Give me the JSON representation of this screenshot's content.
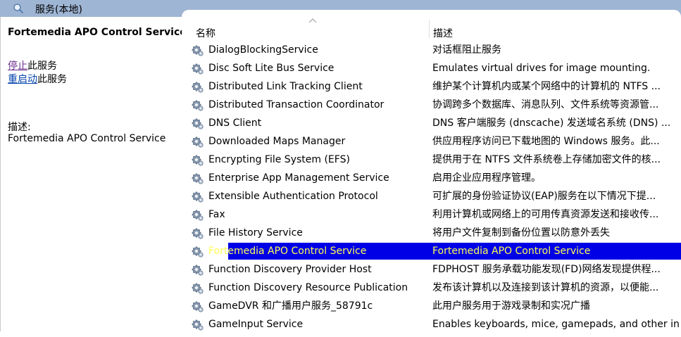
{
  "window": {
    "title": "服务(本地)"
  },
  "left": {
    "service_title": "Fortemedia APO Control Service",
    "stop_link": "停止",
    "stop_suffix": "此服务",
    "restart_link": "重启动",
    "restart_suffix": "此服务",
    "desc_label": "描述:",
    "desc_text": "Fortemedia APO Control Service"
  },
  "table": {
    "headers": {
      "name": "名称",
      "desc": "描述"
    },
    "selected_index": 12,
    "rows": [
      {
        "name": "DialogBlockingService",
        "desc": "对话框阻止服务"
      },
      {
        "name": "Disc Soft Lite Bus Service",
        "desc": "Emulates virtual drives for image mounting."
      },
      {
        "name": "Distributed Link Tracking Client",
        "desc": "维护某个计算机内或某个网络中的计算机的 NTFS ..."
      },
      {
        "name": "Distributed Transaction Coordinator",
        "desc": "协调跨多个数据库、消息队列、文件系统等资源管..."
      },
      {
        "name": "DNS Client",
        "desc": "DNS 客户端服务 (dnscache) 发送域名系统 (DNS) ..."
      },
      {
        "name": "Downloaded Maps Manager",
        "desc": "供应用程序访问已下载地图的 Windows 服务。此..."
      },
      {
        "name": "Encrypting File System (EFS)",
        "desc": "提供用于在 NTFS 文件系统卷上存储加密文件的核..."
      },
      {
        "name": "Enterprise App Management Service",
        "desc": "启用企业应用程序管理。"
      },
      {
        "name": "Extensible Authentication Protocol",
        "desc": "可扩展的身份验证协议(EAP)服务在以下情况下提..."
      },
      {
        "name": "Fax",
        "desc": "利用计算机或网络上的可用传真资源发送和接收传..."
      },
      {
        "name": "File History Service",
        "desc": "将用户文件复制到备份位置以防意外丢失"
      },
      {
        "name": "Fortemedia APO Control Service",
        "desc": "Fortemedia APO Control Service"
      },
      {
        "name": "Function Discovery Provider Host",
        "desc": "FDPHOST 服务承载功能发现(FD)网络发现提供程..."
      },
      {
        "name": "Function Discovery Resource Publication",
        "desc": "发布该计算机以及连接到该计算机的资源，以便能..."
      },
      {
        "name": "GameDVR 和广播用户服务_58791c",
        "desc": "此用户服务用于游戏录制和实况广播"
      },
      {
        "name": "GameInput Service",
        "desc": "Enables keyboards, mice, gamepads, and other in..."
      }
    ]
  },
  "colors": {
    "selection": "#0000e6",
    "selection_text": "#ffff55",
    "titlebar": "#9fb5d4"
  }
}
